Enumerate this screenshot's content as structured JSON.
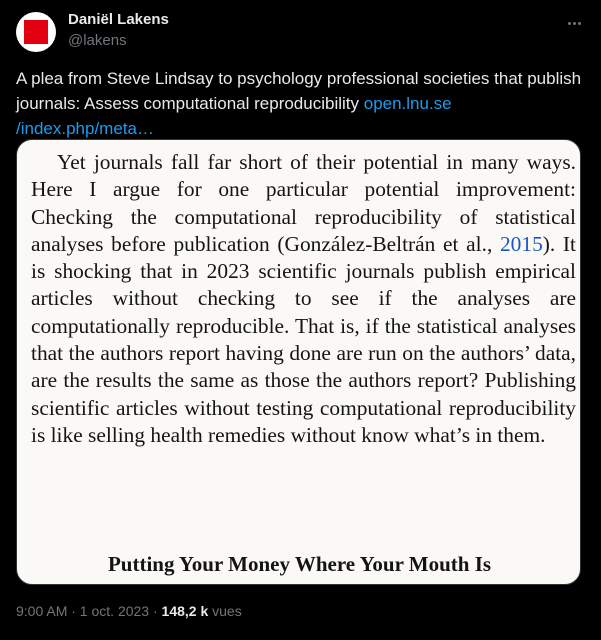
{
  "author": {
    "name": "Daniël Lakens",
    "handle": "@lakens"
  },
  "tweet": {
    "text": "A plea from Steve Lindsay to psychology professional societies that publish journals: Assess computational reproducibility ",
    "link_line1": "open.lnu.se",
    "link_line2": "/index.php/meta…"
  },
  "media": {
    "paragraph_part1": "Yet journals fall far short of their potential in many ways. Here I argue for one particular potential improvement: Checking the computational reproducibility of statistical analyses before publication (González-Beltrán et al., ",
    "citation_year": "2015",
    "paragraph_part2": "). It is shocking that in 2023 scientific journals publish empirical articles without checking to see if the analyses are computationally reproducible. That is, if the statistical analyses that the authors report having done are run on the authors’ data, are the results the same as those the authors report? Publishing scientific articles without testing computational reproducibility is like selling health remedies without know what’s in them.",
    "section_heading": "Putting Your Money Where Your Mouth Is"
  },
  "meta": {
    "timestamp": "9:00 AM · 1 oct. 2023 · ",
    "views_count": "148,2 k",
    "views_label": " vues"
  },
  "colors": {
    "background": "#000000",
    "link": "#1d9bf0",
    "muted": "#71767b",
    "avatar_red": "#e3000f"
  },
  "icons": {
    "more": "more-horizontal-icon"
  }
}
